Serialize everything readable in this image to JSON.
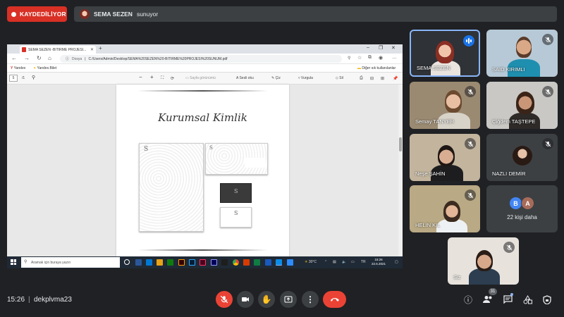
{
  "recording": {
    "label": "KAYDEDİLİYOR"
  },
  "presentation": {
    "presenter": "SEMA SEZEN",
    "action": "sunuyor"
  },
  "browser": {
    "tab_title": "SEMA SEZEN -BITIRME PROJESI...",
    "url_prefix": "Dosya",
    "url": "C:/Users/Admin/Desktop/SEMA%20SEZEN%20-BITIRME%20PROJESI%20SUNUM.pdf",
    "bookmarks": [
      "Yandex",
      "Yandex.Bilet"
    ],
    "other_bookmarks": "Diğer sık kullanılanlar"
  },
  "pdf": {
    "page": "5",
    "total": "/1",
    "tools": [
      "Sayfa görünümü",
      "Sesli oku",
      "Çiz",
      "Vurgula",
      "Sil"
    ],
    "slide_title": "Kurumsal Kimlik"
  },
  "taskbar": {
    "search_placeholder": "Aramak için buraya yazın",
    "weather": "30°C",
    "time": "15:26",
    "date": "22.6.2021"
  },
  "participants": [
    {
      "name": "SEMA SEZEN",
      "muted": false,
      "speaking": true
    },
    {
      "name": "SAID KIRIMLI",
      "muted": true
    },
    {
      "name": "Semay TANYER",
      "muted": true
    },
    {
      "name": "Çiğdem TAŞTEPE",
      "muted": true
    },
    {
      "name": "Neşe ŞAHİN",
      "muted": true
    },
    {
      "name": "NAZLI DEMİR",
      "muted": true
    },
    {
      "name": "HELİN KIL",
      "muted": true
    },
    {
      "name": "Siz",
      "muted": true
    }
  ],
  "more": {
    "avatars": [
      "B",
      "A"
    ],
    "label": "22 kişi daha"
  },
  "meeting": {
    "time": "15:26",
    "separator": "|",
    "code": "dekplvma23",
    "participant_count": "31"
  },
  "colors": {
    "accent": "#8ab4f8",
    "danger": "#ea4335",
    "speaking": "#1a73e8",
    "avatar_b": "#4285f4",
    "avatar_a": "#a76b5a"
  }
}
